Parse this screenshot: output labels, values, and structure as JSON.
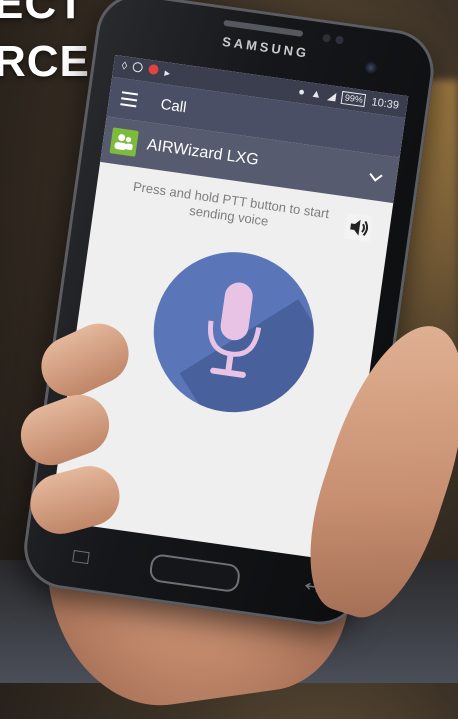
{
  "headline": {
    "line1": "ECT",
    "line2": "RCE"
  },
  "device": {
    "brand": "SAMSUNG"
  },
  "status_bar": {
    "battery": "99%",
    "time": "10:39"
  },
  "app_bar": {
    "title": "Call",
    "menu_icon": "menu-icon"
  },
  "group": {
    "name": "AIRWizard LXG",
    "icon": "group-icon",
    "expand_icon": "chevron-down-icon"
  },
  "ptt": {
    "hint": "Press and hold PTT button to start sending voice",
    "button_icon": "microphone-icon",
    "speaker_icon": "speaker-icon"
  },
  "colors": {
    "appbar": "#4a4f65",
    "group_row": "#565b70",
    "group_icon": "#7dbb3c",
    "ptt_button": "#5a76b8",
    "screen_bg": "#efefef"
  }
}
